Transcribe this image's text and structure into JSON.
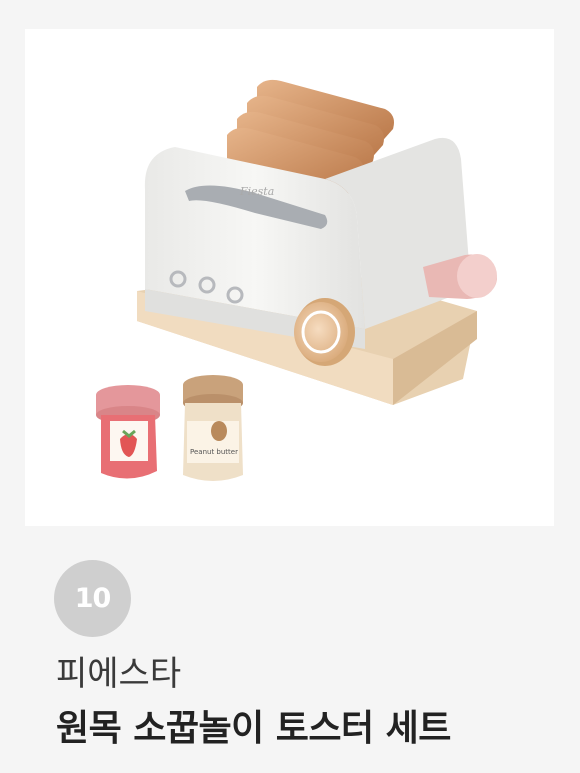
{
  "product": {
    "rank": "10",
    "brand": "피에스타",
    "name": "원목 소꿉놀이 토스터 세트",
    "image": {
      "subject": "wooden-toaster-toy-set",
      "toaster_logo_text": "Fiesta",
      "jar_labels": [
        "strawberry",
        "Peanut butter"
      ]
    }
  },
  "colors": {
    "page_background": "#f5f5f5",
    "image_background": "#ffffff",
    "badge": "#cfcfcf",
    "brand_text": "#3a3a3a",
    "name_text": "#222222"
  }
}
